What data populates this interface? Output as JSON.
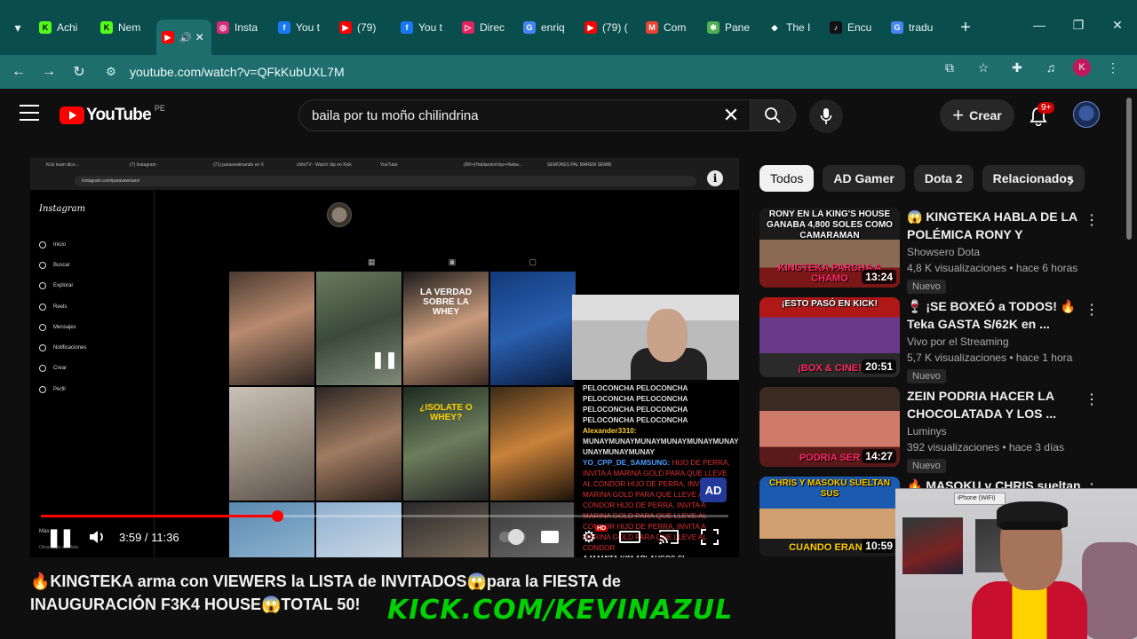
{
  "browser": {
    "tabs": [
      {
        "title": "Achi",
        "icon": "kick-icon",
        "color": "#53fc18"
      },
      {
        "title": "Nem",
        "icon": "kick-icon",
        "color": "#53fc18"
      },
      {
        "title": "",
        "icon": "youtube-icon",
        "color": "#ff0000",
        "active": true
      },
      {
        "title": "Insta",
        "icon": "instagram-icon",
        "color": "#d62976"
      },
      {
        "title": "You t",
        "icon": "facebook-icon",
        "color": "#1877f2"
      },
      {
        "title": "(79)",
        "icon": "youtube-icon",
        "color": "#ff0000"
      },
      {
        "title": "You t",
        "icon": "facebook-icon",
        "color": "#1877f2"
      },
      {
        "title": "Direc",
        "icon": "direct-icon",
        "color": "#e0245e"
      },
      {
        "title": "enriq",
        "icon": "google-icon",
        "color": "#4285f4"
      },
      {
        "title": "(79) (",
        "icon": "youtube-icon",
        "color": "#ff0000"
      },
      {
        "title": "Com",
        "icon": "gmail-icon",
        "color": "#ea4335"
      },
      {
        "title": "Pane",
        "icon": "extension-icon",
        "color": "#4caf50"
      },
      {
        "title": "The I",
        "icon": "shield-icon",
        "color": "#ffffff"
      },
      {
        "title": "Encu",
        "icon": "tiktok-icon",
        "color": "#000000"
      },
      {
        "title": "tradu",
        "icon": "google-icon",
        "color": "#4285f4"
      }
    ],
    "url": "youtube.com/watch?v=QFkKubUXL7M",
    "profile_initial": "K"
  },
  "youtube": {
    "logo_text": "YouTube",
    "region": "PE",
    "search_query": "baila por tu moño chilindrina",
    "create_label": "Crear",
    "notif_count": "9+"
  },
  "player": {
    "time": "3:59 / 11:36",
    "progress": 0.344,
    "hd": "HD",
    "inner_screen": {
      "tabs": [
        "Kick team dice...",
        "(7) Instagram",
        "(71) parasewlinando en X",
        "chiloTV - Watch clip en Kick",
        "YouTube",
        "(RR+)Hablando#clip+#bebe...",
        "SEMONES PAL MAREM SEMBI"
      ],
      "url": "instagram.com/parasawnuevi",
      "logo": "Instagram",
      "nav": [
        "Inicio",
        "Buscar",
        "Explorar",
        "Reels",
        "Mensajes",
        "Notificaciones",
        "Crear",
        "Perfil"
      ],
      "more": "Más",
      "meta": "Otras apps de Meta",
      "tile_texts": {
        "whey": "LA VERDAD SOBRE LA WHEY",
        "isolate": "¿ISOLATE O WHEY?"
      },
      "chat": [
        {
          "user": "",
          "text": "PELOCONCHA PELOCONCHA PELOCONCHA PELOCONCHA PELOCONCHA PELOCONCHA PELOCONCHA PELOCONCHA"
        },
        {
          "user": "Alexander3310:",
          "text": "MUNAYMUNAYMUNAYMUNAYMUNAYMUNAYM UNAYMUNAYMUNAY"
        },
        {
          "user": "YO_CPP_DE_SAMSUNG:",
          "text": "HIJO DE PERRA, INVITA A MARINA GOLD PARA QUE LLEVE AL CONDOR HIJO DE PERRA, INVITA A MARINA GOLD PARA QUE LLEVE AL CONDOR HIJO DE PERRA, INVITA A MARINA GOLD PARA QUE LLEVE AL CONDOR HIJO DE PERRA, INVITA A MARINA GOLD PARA QUE LLEVE AL CONDOR"
        },
        {
          "user": "",
          "text": "A MAMITA KIM APLAUSOS SI"
        }
      ],
      "ad_badge": "AD"
    }
  },
  "video_title": "🔥KINGTEKA arma con VIEWERS la LISTA de INVITADOS😱para la FIESTA de INAUGURACIÓN F3K4 HOUSE😱TOTAL 50!",
  "kick_overlay": "KICK.COM/KEVINAZUL",
  "chips": [
    "Todos",
    "AD Gamer",
    "Dota 2",
    "Relacionados"
  ],
  "recommendations": [
    {
      "title": "😱 KINGTEKA HABLA DE LA POLÉMICA RONY Y MILENKA, ...",
      "channel": "Showsero Dota",
      "stats": "4,8 K visualizaciones • hace 6 horas",
      "badge": "Nuevo",
      "duration": "13:24",
      "thumb_top": "RONY EN LA KING'S HOUSE GANABA 4,800 SOLES COMO CAMARAMAN",
      "thumb_bottom": "KINGTEKA PARCHA A CHAMO"
    },
    {
      "title": "🍷 ¡SE BOXEÓ a TODOS! 🔥 Teka GASTA S/62K en ...",
      "channel": "Vivo por el Streaming",
      "stats": "5,7 K visualizaciones • hace 1 hora",
      "badge": "Nuevo",
      "duration": "20:51",
      "thumb_top": "¡ESTO PASÓ EN KICK!",
      "thumb_bottom": "¡BOX & CINE!"
    },
    {
      "title": "ZEIN PODRIA HACER LA CHOCOLATADA Y LOS ...",
      "channel": "Luminys",
      "stats": "392 visualizaciones • hace 3 días",
      "badge": "Nuevo",
      "duration": "14:27",
      "thumb_top": "",
      "thumb_bottom": "PODRIA SER"
    },
    {
      "title": "🔥 MASOKU y CHRIS sueltan ...",
      "channel": "",
      "stats": "",
      "badge": "",
      "duration": "10:59",
      "thumb_top": "CHRIS Y MASOKU SUELTAN SUS",
      "thumb_bottom": "CUANDO ERAN 1"
    }
  ],
  "webcam_label": "iPhone (WiFi)"
}
